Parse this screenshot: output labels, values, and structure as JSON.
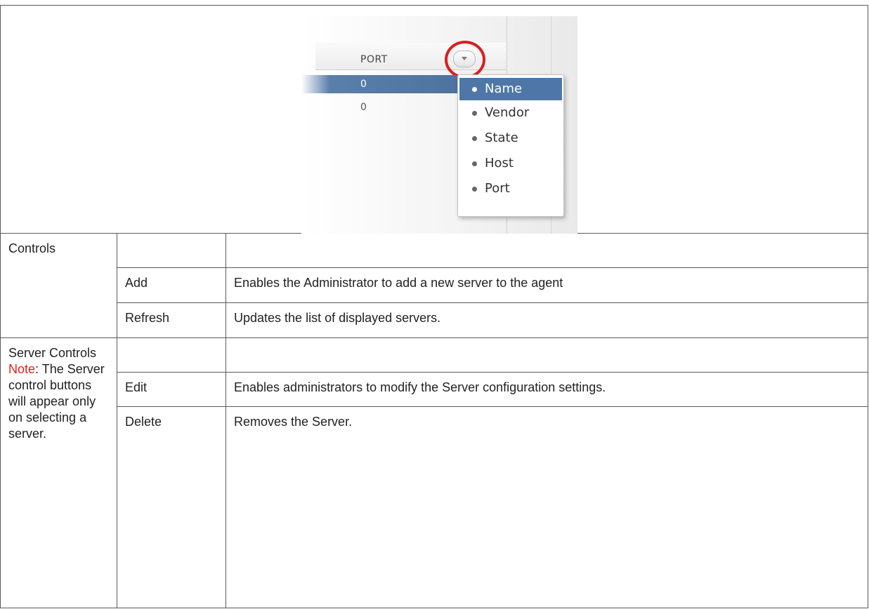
{
  "screenshot": {
    "column_header": "PORT",
    "rows": [
      "0",
      "0"
    ],
    "menu_items": [
      {
        "label": "Name",
        "selected": true
      },
      {
        "label": "Vendor",
        "selected": false
      },
      {
        "label": "State",
        "selected": false
      },
      {
        "label": "Host",
        "selected": false
      },
      {
        "label": "Port",
        "selected": false
      }
    ]
  },
  "sections": {
    "controls": {
      "label": "Controls",
      "rows": [
        {
          "name": "Add",
          "description": "Enables the Administrator to add a new server to the agent"
        },
        {
          "name": "Refresh",
          "description": "Updates the list of displayed servers."
        }
      ]
    },
    "server_controls": {
      "label": "Server Controls",
      "note_label": "Note",
      "note_text": ": The Server control buttons will appear only on selecting a server.",
      "rows": [
        {
          "name": "Edit",
          "description": "Enables administrators to modify the Server configuration settings."
        },
        {
          "name": "Delete",
          "description": "Removes the Server."
        }
      ]
    }
  },
  "colors": {
    "note": "#e0241b",
    "highlight_circle": "#d91f1f",
    "selection": "#4e77a8"
  }
}
